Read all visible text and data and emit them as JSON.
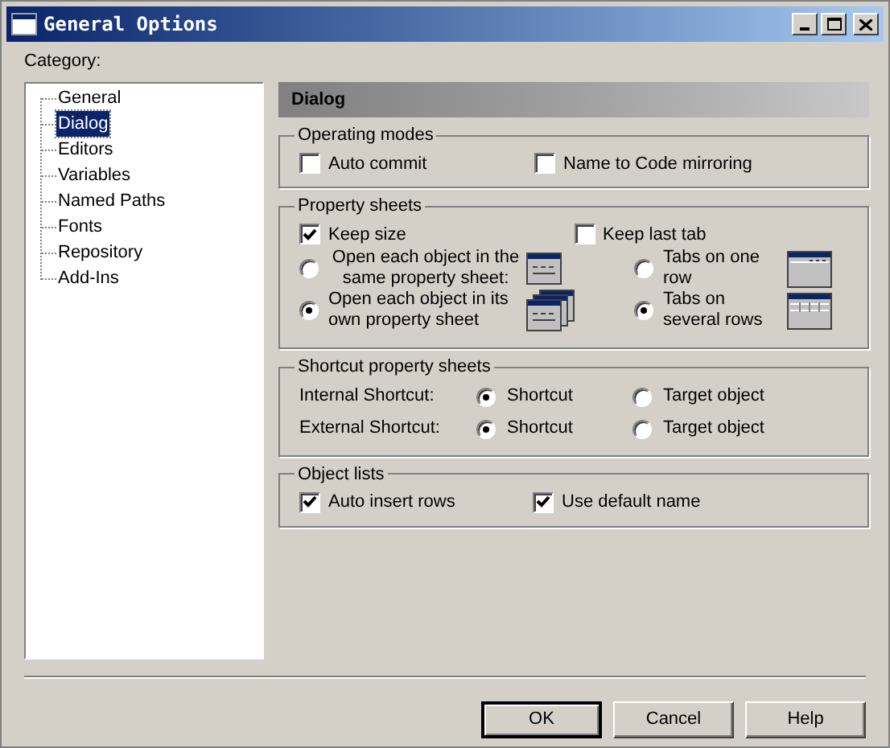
{
  "window": {
    "title": "General Options"
  },
  "category": {
    "label": "Category:",
    "items": [
      {
        "label": "General",
        "selected": false
      },
      {
        "label": "Dialog",
        "selected": true
      },
      {
        "label": "Editors",
        "selected": false
      },
      {
        "label": "Variables",
        "selected": false
      },
      {
        "label": "Named Paths",
        "selected": false
      },
      {
        "label": "Fonts",
        "selected": false
      },
      {
        "label": "Repository",
        "selected": false
      },
      {
        "label": "Add-Ins",
        "selected": false
      }
    ]
  },
  "panel": {
    "title": "Dialog"
  },
  "operating_modes": {
    "title": "Operating modes",
    "checkboxes": [
      {
        "label": "Auto commit",
        "checked": false
      },
      {
        "label": "Name to Code mirroring",
        "checked": false
      }
    ]
  },
  "property_sheets": {
    "title": "Property sheets",
    "checkboxes": [
      {
        "label": "Keep size",
        "checked": true
      },
      {
        "label": "Keep last tab",
        "checked": false
      }
    ],
    "open_options": [
      {
        "label": "Open each object in the same property sheet:",
        "selected": false
      },
      {
        "label": "Open each object in its own property sheet",
        "selected": true
      }
    ],
    "tab_options": [
      {
        "label": "Tabs on one row",
        "selected": false
      },
      {
        "label": "Tabs on several rows",
        "selected": true
      }
    ]
  },
  "shortcut_sheets": {
    "title": "Shortcut property sheets",
    "rows": [
      {
        "label": "Internal Shortcut:",
        "options": [
          {
            "label": "Shortcut",
            "selected": true
          },
          {
            "label": "Target object",
            "selected": false
          }
        ]
      },
      {
        "label": "External Shortcut:",
        "options": [
          {
            "label": "Shortcut",
            "selected": true
          },
          {
            "label": "Target object",
            "selected": false
          }
        ]
      }
    ]
  },
  "object_lists": {
    "title": "Object lists",
    "checkboxes": [
      {
        "label": "Auto insert rows",
        "checked": true
      },
      {
        "label": "Use default name",
        "checked": true
      }
    ]
  },
  "buttons": [
    {
      "label": "OK",
      "default": true
    },
    {
      "label": "Cancel",
      "default": false
    },
    {
      "label": "Help",
      "default": false
    }
  ]
}
